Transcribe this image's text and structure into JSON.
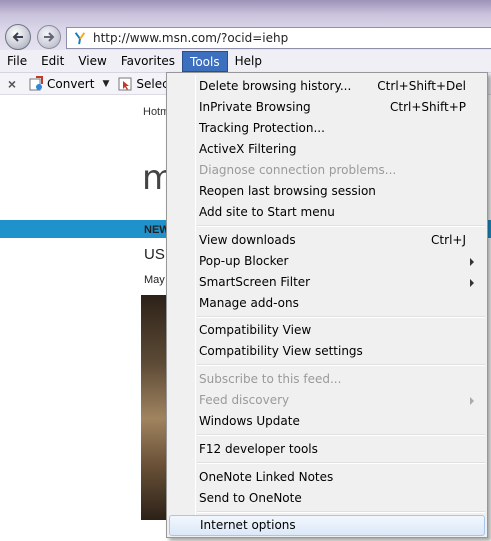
{
  "address": {
    "url": "http://www.msn.com/?ocid=iehp"
  },
  "menubar": {
    "items": [
      {
        "label": "File"
      },
      {
        "label": "Edit"
      },
      {
        "label": "View"
      },
      {
        "label": "Favorites"
      },
      {
        "label": "Tools"
      },
      {
        "label": "Help"
      }
    ]
  },
  "cmdbar": {
    "convert_label": "Convert",
    "select_label": "Select"
  },
  "page": {
    "hotmail": "Hotm",
    "logo": "m",
    "news": "NEW",
    "us": "US",
    "date": "May"
  },
  "tools_menu": {
    "items": [
      {
        "label": "Delete browsing history...",
        "shortcut": "Ctrl+Shift+Del"
      },
      {
        "label": "InPrivate Browsing",
        "shortcut": "Ctrl+Shift+P"
      },
      {
        "label": "Tracking Protection..."
      },
      {
        "label": "ActiveX Filtering"
      },
      {
        "label": "Diagnose connection problems...",
        "disabled": true
      },
      {
        "label": "Reopen last browsing session"
      },
      {
        "label": "Add site to Start menu"
      },
      {
        "label": "View downloads",
        "shortcut": "Ctrl+J"
      },
      {
        "label": "Pop-up Blocker",
        "submenu": true
      },
      {
        "label": "SmartScreen Filter",
        "submenu": true
      },
      {
        "label": "Manage add-ons"
      },
      {
        "label": "Compatibility View"
      },
      {
        "label": "Compatibility View settings"
      },
      {
        "label": "Subscribe to this feed...",
        "disabled": true
      },
      {
        "label": "Feed discovery",
        "disabled": true,
        "submenu": true
      },
      {
        "label": "Windows Update"
      },
      {
        "label": "F12 developer tools"
      },
      {
        "label": "OneNote Linked Notes"
      },
      {
        "label": "Send to OneNote"
      },
      {
        "label": "Internet options",
        "highlighted": true
      }
    ]
  },
  "colors": {
    "menu_highlight": "#3d6fbf",
    "page_band": "#1f92cc"
  }
}
